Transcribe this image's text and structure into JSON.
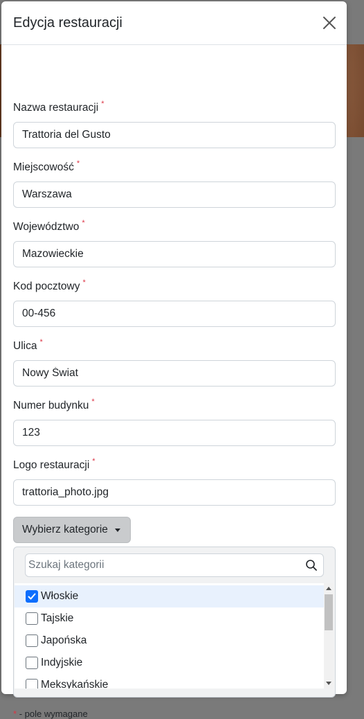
{
  "modal": {
    "title": "Edycja restauracji"
  },
  "fields": [
    {
      "label": "Nazwa restauracji",
      "value": "Trattoria del Gusto"
    },
    {
      "label": "Miejscowość",
      "value": "Warszawa"
    },
    {
      "label": "Województwo",
      "value": "Mazowieckie"
    },
    {
      "label": "Kod pocztowy",
      "value": "00-456"
    },
    {
      "label": "Ulica",
      "value": "Nowy Świat"
    },
    {
      "label": "Numer budynku",
      "value": "123"
    },
    {
      "label": "Logo restauracji",
      "value": "trattoria_photo.jpg"
    }
  ],
  "required_marker": "*",
  "category_dropdown": {
    "button_label": "Wybierz kategorie",
    "search_placeholder": "Szukaj kategorii",
    "items": [
      {
        "label": "Włoskie",
        "checked": true
      },
      {
        "label": "Tajskie",
        "checked": false
      },
      {
        "label": "Japońska",
        "checked": false
      },
      {
        "label": "Indyjskie",
        "checked": false
      },
      {
        "label": "Meksykańskie",
        "checked": false
      }
    ]
  },
  "footer": {
    "required_note": "- pole wymagane"
  },
  "colors": {
    "required": "#dc3545",
    "checkbox_checked": "#0d6efd",
    "selected_row": "#e8f1fd"
  }
}
